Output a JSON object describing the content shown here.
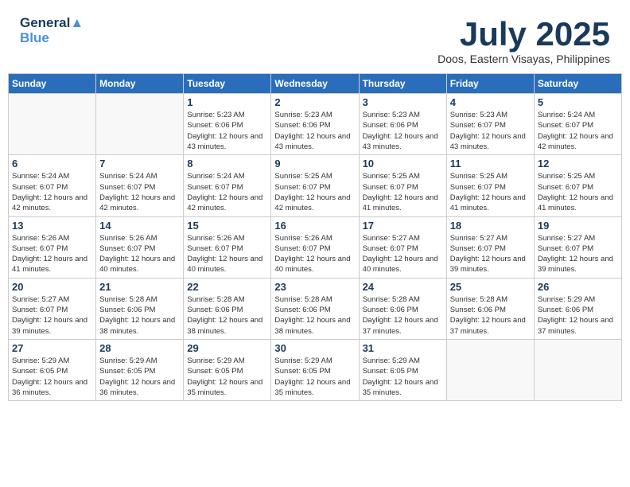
{
  "logo": {
    "line1": "General",
    "line2": "Blue"
  },
  "title": "July 2025",
  "subtitle": "Doos, Eastern Visayas, Philippines",
  "weekdays": [
    "Sunday",
    "Monday",
    "Tuesday",
    "Wednesday",
    "Thursday",
    "Friday",
    "Saturday"
  ],
  "weeks": [
    [
      {
        "day": "",
        "info": ""
      },
      {
        "day": "",
        "info": ""
      },
      {
        "day": "1",
        "info": "Sunrise: 5:23 AM\nSunset: 6:06 PM\nDaylight: 12 hours and 43 minutes."
      },
      {
        "day": "2",
        "info": "Sunrise: 5:23 AM\nSunset: 6:06 PM\nDaylight: 12 hours and 43 minutes."
      },
      {
        "day": "3",
        "info": "Sunrise: 5:23 AM\nSunset: 6:06 PM\nDaylight: 12 hours and 43 minutes."
      },
      {
        "day": "4",
        "info": "Sunrise: 5:23 AM\nSunset: 6:07 PM\nDaylight: 12 hours and 43 minutes."
      },
      {
        "day": "5",
        "info": "Sunrise: 5:24 AM\nSunset: 6:07 PM\nDaylight: 12 hours and 42 minutes."
      }
    ],
    [
      {
        "day": "6",
        "info": "Sunrise: 5:24 AM\nSunset: 6:07 PM\nDaylight: 12 hours and 42 minutes."
      },
      {
        "day": "7",
        "info": "Sunrise: 5:24 AM\nSunset: 6:07 PM\nDaylight: 12 hours and 42 minutes."
      },
      {
        "day": "8",
        "info": "Sunrise: 5:24 AM\nSunset: 6:07 PM\nDaylight: 12 hours and 42 minutes."
      },
      {
        "day": "9",
        "info": "Sunrise: 5:25 AM\nSunset: 6:07 PM\nDaylight: 12 hours and 42 minutes."
      },
      {
        "day": "10",
        "info": "Sunrise: 5:25 AM\nSunset: 6:07 PM\nDaylight: 12 hours and 41 minutes."
      },
      {
        "day": "11",
        "info": "Sunrise: 5:25 AM\nSunset: 6:07 PM\nDaylight: 12 hours and 41 minutes."
      },
      {
        "day": "12",
        "info": "Sunrise: 5:25 AM\nSunset: 6:07 PM\nDaylight: 12 hours and 41 minutes."
      }
    ],
    [
      {
        "day": "13",
        "info": "Sunrise: 5:26 AM\nSunset: 6:07 PM\nDaylight: 12 hours and 41 minutes."
      },
      {
        "day": "14",
        "info": "Sunrise: 5:26 AM\nSunset: 6:07 PM\nDaylight: 12 hours and 40 minutes."
      },
      {
        "day": "15",
        "info": "Sunrise: 5:26 AM\nSunset: 6:07 PM\nDaylight: 12 hours and 40 minutes."
      },
      {
        "day": "16",
        "info": "Sunrise: 5:26 AM\nSunset: 6:07 PM\nDaylight: 12 hours and 40 minutes."
      },
      {
        "day": "17",
        "info": "Sunrise: 5:27 AM\nSunset: 6:07 PM\nDaylight: 12 hours and 40 minutes."
      },
      {
        "day": "18",
        "info": "Sunrise: 5:27 AM\nSunset: 6:07 PM\nDaylight: 12 hours and 39 minutes."
      },
      {
        "day": "19",
        "info": "Sunrise: 5:27 AM\nSunset: 6:07 PM\nDaylight: 12 hours and 39 minutes."
      }
    ],
    [
      {
        "day": "20",
        "info": "Sunrise: 5:27 AM\nSunset: 6:07 PM\nDaylight: 12 hours and 39 minutes."
      },
      {
        "day": "21",
        "info": "Sunrise: 5:28 AM\nSunset: 6:06 PM\nDaylight: 12 hours and 38 minutes."
      },
      {
        "day": "22",
        "info": "Sunrise: 5:28 AM\nSunset: 6:06 PM\nDaylight: 12 hours and 38 minutes."
      },
      {
        "day": "23",
        "info": "Sunrise: 5:28 AM\nSunset: 6:06 PM\nDaylight: 12 hours and 38 minutes."
      },
      {
        "day": "24",
        "info": "Sunrise: 5:28 AM\nSunset: 6:06 PM\nDaylight: 12 hours and 37 minutes."
      },
      {
        "day": "25",
        "info": "Sunrise: 5:28 AM\nSunset: 6:06 PM\nDaylight: 12 hours and 37 minutes."
      },
      {
        "day": "26",
        "info": "Sunrise: 5:29 AM\nSunset: 6:06 PM\nDaylight: 12 hours and 37 minutes."
      }
    ],
    [
      {
        "day": "27",
        "info": "Sunrise: 5:29 AM\nSunset: 6:05 PM\nDaylight: 12 hours and 36 minutes."
      },
      {
        "day": "28",
        "info": "Sunrise: 5:29 AM\nSunset: 6:05 PM\nDaylight: 12 hours and 36 minutes."
      },
      {
        "day": "29",
        "info": "Sunrise: 5:29 AM\nSunset: 6:05 PM\nDaylight: 12 hours and 35 minutes."
      },
      {
        "day": "30",
        "info": "Sunrise: 5:29 AM\nSunset: 6:05 PM\nDaylight: 12 hours and 35 minutes."
      },
      {
        "day": "31",
        "info": "Sunrise: 5:29 AM\nSunset: 6:05 PM\nDaylight: 12 hours and 35 minutes."
      },
      {
        "day": "",
        "info": ""
      },
      {
        "day": "",
        "info": ""
      }
    ]
  ]
}
